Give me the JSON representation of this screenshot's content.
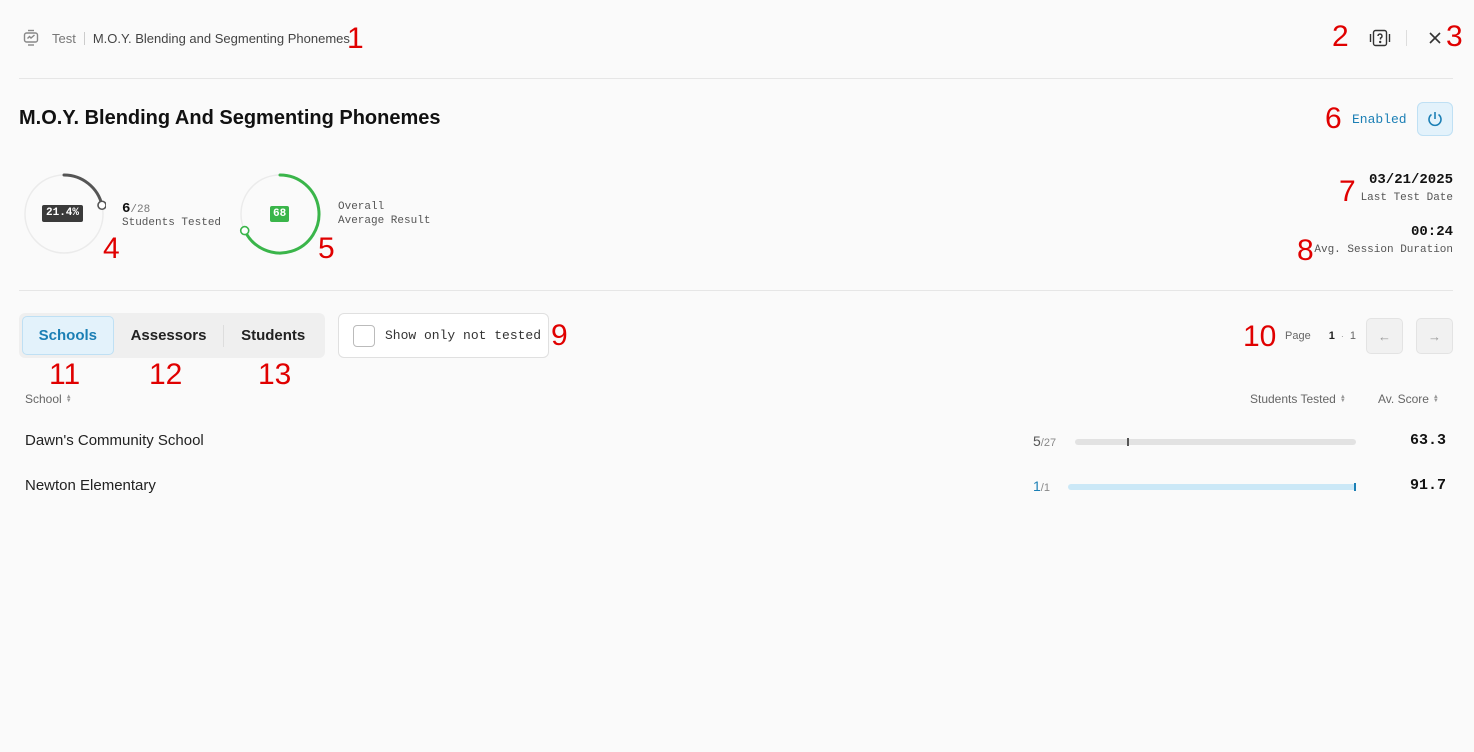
{
  "header": {
    "breadcrumb": [
      "Test",
      "M.O.Y. Blending and Segmenting Phonemes"
    ],
    "annotations": {
      "breadcrumb": "1",
      "help": "2",
      "close": "3"
    }
  },
  "page": {
    "title": "M.O.Y. Blending And Segmenting Phonemes",
    "status": "Enabled",
    "annotations": {
      "status": "6"
    }
  },
  "stats": {
    "tested_percent": "21.4%",
    "tested_fraction": 0.214,
    "tested_count": "6",
    "tested_total": "/28",
    "tested_label": "Students Tested",
    "avg_result": "68",
    "avg_result_fraction": 0.68,
    "avg_label_1": "Overall",
    "avg_label_2": "Average Result",
    "last_test_date": "03/21/2025",
    "last_test_label": "Last Test Date",
    "avg_duration": "00:24",
    "avg_duration_label": "Avg. Session Duration",
    "annotations": {
      "tested": "4",
      "avg": "5",
      "date": "7",
      "duration": "8"
    }
  },
  "toolbar": {
    "tabs": [
      "Schools",
      "Assessors",
      "Students"
    ],
    "active_tab": "Schools",
    "filter_label": "Show only not tested",
    "pager_label": "Page",
    "page_current": "1",
    "page_total": "1",
    "annotations": {
      "filter": "9",
      "pager": "10",
      "tab_schools": "11",
      "tab_assessors": "12",
      "tab_students": "13"
    }
  },
  "table": {
    "columns": {
      "school": "School",
      "tested": "Students Tested",
      "score": "Av. Score"
    },
    "rows": [
      {
        "name": "Dawn's Community School",
        "tested": "5",
        "total": "/27",
        "fraction": 0.185,
        "score": "63.3",
        "color": "#555555",
        "track_color": "#e2e2e2"
      },
      {
        "name": "Newton Elementary",
        "tested": "1",
        "total": "/1",
        "fraction": 1.0,
        "score": "91.7",
        "color": "#1b7fb5",
        "track_color": "#cbe8f7"
      }
    ]
  },
  "colors": {
    "accent": "#1b7fb5",
    "success": "#3ab54a",
    "dark_badge": "#3a3a3a",
    "annotation": "#e00000"
  }
}
